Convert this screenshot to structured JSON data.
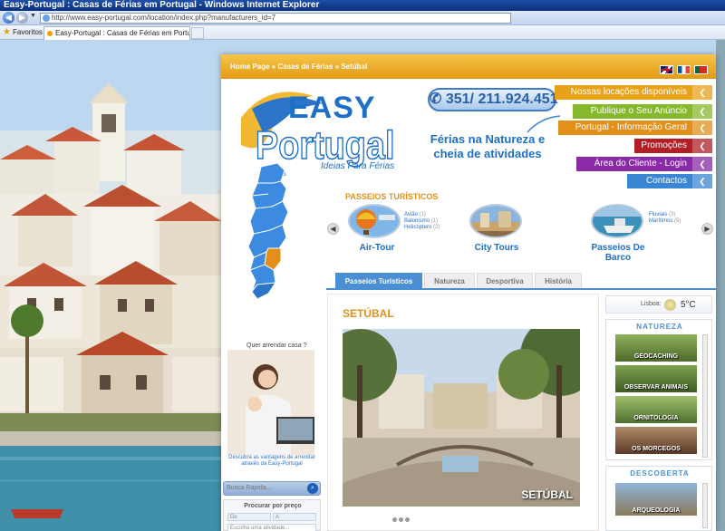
{
  "browser": {
    "window_title": "Easy-Portugal : Casas de Férias em Portugal - Windows Internet Explorer",
    "url": "http://www.easy-portugal.com/location/index.php?manufacturers_id=7",
    "favorites_label": "Favoritos",
    "tab_title": "Easy-Portugal : Casas de Férias em Portugal"
  },
  "header": {
    "breadcrumb": "Home Page » Casas de Férias » Setúbal"
  },
  "logo": {
    "easy": "EASY",
    "portugal": "Portugal",
    "tagline": "Ideias Para Férias"
  },
  "contact": {
    "phone": "351/ 211.924.451",
    "slogan": "Férias na Natureza e cheia de atividades"
  },
  "menu": [
    {
      "label": "Nossas locações disponíveis",
      "color": "#e8a21a"
    },
    {
      "label": "Publique o Seu Anúncio",
      "color": "#86b82b"
    },
    {
      "label": "Portugal - Informação Geral",
      "color": "#e3901a"
    },
    {
      "label": "Promoções",
      "color": "#b21e24"
    },
    {
      "label": "Área do Cliente - Login",
      "color": "#8a2aa8"
    },
    {
      "label": "Contactos",
      "color": "#3b86d4"
    }
  ],
  "map": {
    "label": "distritos"
  },
  "tours": {
    "title": "PASSEIOS TURÍSTICOS",
    "items": [
      {
        "label": "Air-Tour",
        "subs": [
          {
            "name": "Avião",
            "count": "(1)"
          },
          {
            "name": "Balonismo",
            "count": "(1)"
          },
          {
            "name": "Helicóptero",
            "count": "(2)"
          }
        ]
      },
      {
        "label": "City Tours",
        "subs": []
      },
      {
        "label": "Passeios De Barco",
        "subs": [
          {
            "name": "Fluviais",
            "count": "(3)"
          },
          {
            "name": "Marítimos",
            "count": "(5)"
          }
        ]
      }
    ]
  },
  "tabs": [
    "Passeios Turísticos",
    "Natureza",
    "Desportiva",
    "História"
  ],
  "content": {
    "city_title": "SETÚBAL",
    "photo_label": "SETÚBAL"
  },
  "rent": {
    "title": "Quer arrendar casa ?",
    "caption": "Descubra as vantagens de arrendar através da Easy-Portugal"
  },
  "search": {
    "placeholder": "Busca Rápida...",
    "price_title": "Procurar por preço",
    "price_from": "De",
    "price_to": "A",
    "activity": "Escolha uma atividade..."
  },
  "weather": {
    "city": "Lisboa:",
    "temp": "5°C"
  },
  "sidebar": {
    "natureza_title": "NATUREZA",
    "natureza_items": [
      "GEOCACHING",
      "OBSERVAR ANIMAIS",
      "ORNITOLOGIA",
      "OS MORCEGOS"
    ],
    "descoberta_title": "DESCOBERTA",
    "descoberta_items": [
      "ARQUEOLOGIA"
    ]
  }
}
